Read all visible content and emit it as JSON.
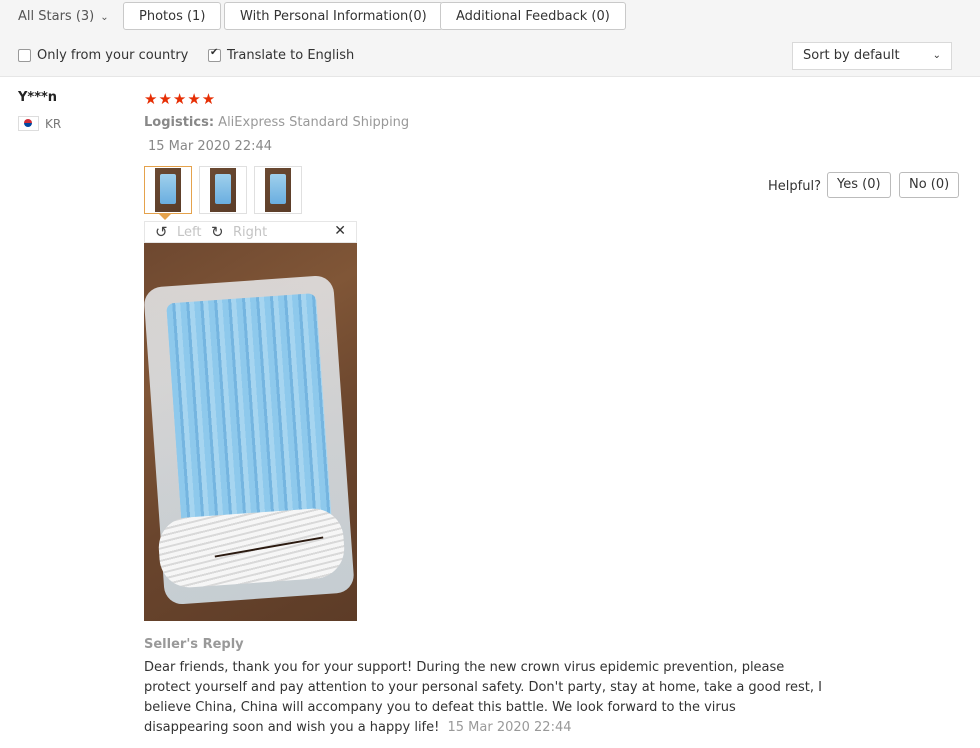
{
  "filters": {
    "stars_label": "All Stars (3)",
    "photos_label": "Photos (1)",
    "personal_label": "With Personal Information(0)",
    "feedback_label": "Additional Feedback (0)",
    "country_checkbox": {
      "label": "Only from your country",
      "checked": false
    },
    "translate_checkbox": {
      "label": "Translate to English",
      "checked": true
    },
    "sort_label": "Sort by default"
  },
  "review": {
    "user": "Y***n",
    "country": "KR",
    "stars": "★★★★★",
    "rating": 5,
    "logistics_label": "Logistics:",
    "logistics_value": "AliExpress Standard Shipping",
    "date": "15 Mar 2020 22:44",
    "viewer": {
      "left_label": "Left",
      "right_label": "Right"
    },
    "helpful_label": "Helpful?",
    "yes_label": "Yes (0)",
    "no_label": "No (0)"
  },
  "seller_reply": {
    "title": "Seller's Reply",
    "text": "Dear friends, thank you for your support! During the new crown virus epidemic prevention, please protect yourself and pay attention to your personal safety. Don't party, stay at home, take a good rest, I believe China, China will accompany you to defeat this battle. We look forward to the virus disappearing soon and wish you a happy life!",
    "date": "15 Mar 2020 22:44"
  },
  "colors": {
    "star": "#e62e04",
    "active_thumb": "#e5a24c"
  }
}
